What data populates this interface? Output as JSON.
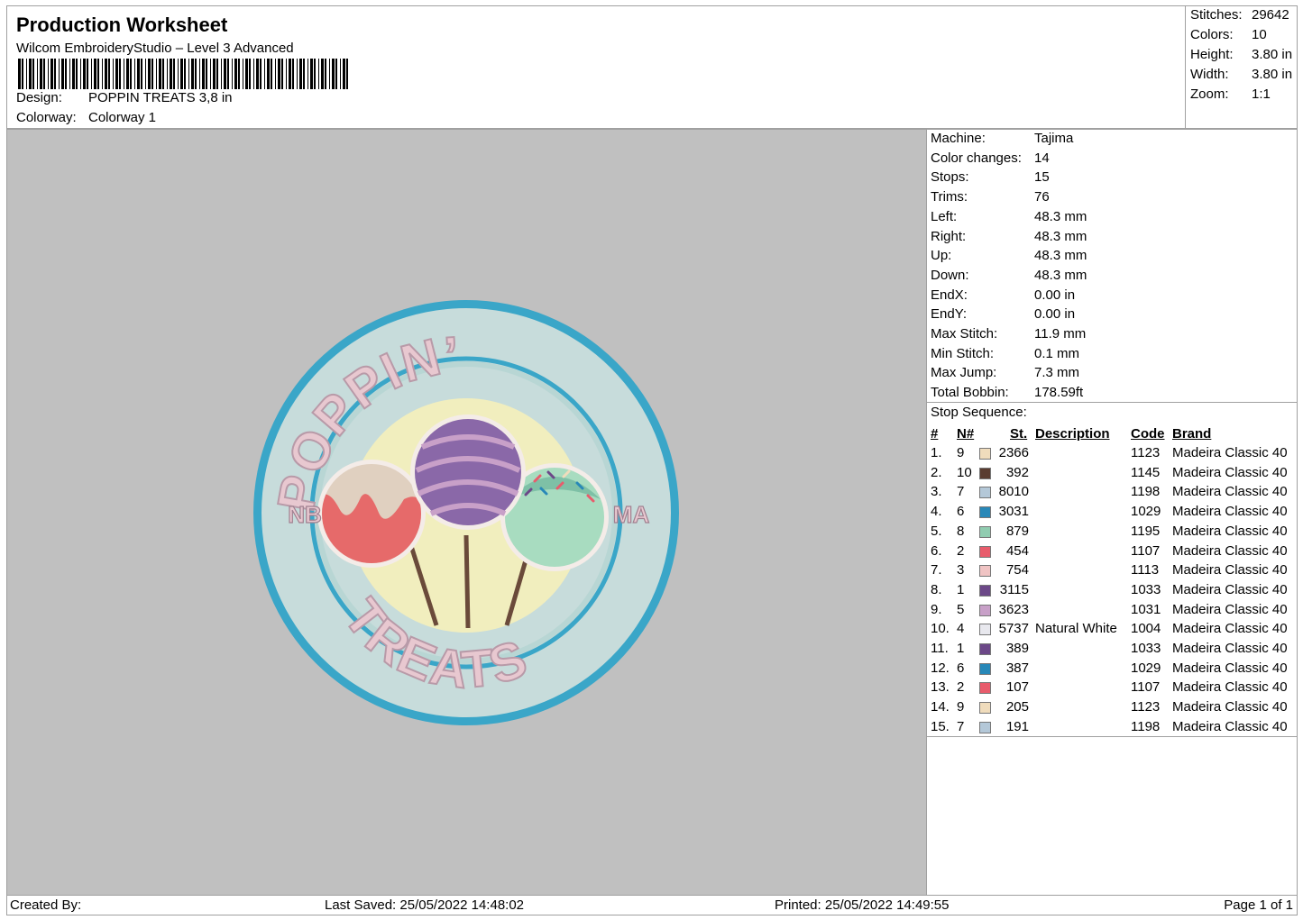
{
  "header": {
    "title": "Production Worksheet",
    "software": "Wilcom EmbroideryStudio – Level 3 Advanced",
    "design_label": "Design:",
    "design_value": "POPPIN TREATS 3,8 in",
    "colorway_label": "Colorway:",
    "colorway_value": "Colorway 1"
  },
  "summary": [
    {
      "label": "Stitches:",
      "value": "29642"
    },
    {
      "label": "Colors:",
      "value": "10"
    },
    {
      "label": "Height:",
      "value": "3.80 in"
    },
    {
      "label": "Width:",
      "value": "3.80 in"
    },
    {
      "label": "Zoom:",
      "value": "1:1"
    }
  ],
  "machine": [
    {
      "label": "Machine:",
      "value": "Tajima"
    },
    {
      "label": "Color changes:",
      "value": "14"
    },
    {
      "label": "Stops:",
      "value": "15"
    },
    {
      "label": "Trims:",
      "value": "76"
    },
    {
      "label": "Left:",
      "value": "48.3 mm"
    },
    {
      "label": "Right:",
      "value": "48.3 mm"
    },
    {
      "label": "Up:",
      "value": "48.3 mm"
    },
    {
      "label": "Down:",
      "value": "48.3 mm"
    },
    {
      "label": "EndX:",
      "value": "0.00 in"
    },
    {
      "label": "EndY:",
      "value": "0.00 in"
    },
    {
      "label": "Max Stitch:",
      "value": "11.9 mm"
    },
    {
      "label": "Min Stitch:",
      "value": "0.1 mm"
    },
    {
      "label": "Max Jump:",
      "value": "7.3 mm"
    },
    {
      "label": "Total Bobbin:",
      "value": "178.59ft"
    }
  ],
  "stop_sequence": {
    "title": "Stop Sequence:",
    "headers": {
      "num": "#",
      "n": "N#",
      "st": "St.",
      "desc": "Description",
      "code": "Code",
      "brand": "Brand"
    },
    "rows": [
      {
        "num": "1.",
        "n": "9",
        "color": "#f0dcbc",
        "st": "2366",
        "desc": "",
        "code": "1123",
        "brand": "Madeira Classic 40"
      },
      {
        "num": "2.",
        "n": "10",
        "color": "#5a3c30",
        "st": "392",
        "desc": "",
        "code": "1145",
        "brand": "Madeira Classic 40"
      },
      {
        "num": "3.",
        "n": "7",
        "color": "#b4c8d8",
        "st": "8010",
        "desc": "",
        "code": "1198",
        "brand": "Madeira Classic 40"
      },
      {
        "num": "4.",
        "n": "6",
        "color": "#2888b8",
        "st": "3031",
        "desc": "",
        "code": "1029",
        "brand": "Madeira Classic 40"
      },
      {
        "num": "5.",
        "n": "8",
        "color": "#90ccb0",
        "st": "879",
        "desc": "",
        "code": "1195",
        "brand": "Madeira Classic 40"
      },
      {
        "num": "6.",
        "n": "2",
        "color": "#e85c6c",
        "st": "454",
        "desc": "",
        "code": "1107",
        "brand": "Madeira Classic 40"
      },
      {
        "num": "7.",
        "n": "3",
        "color": "#f0c4c4",
        "st": "754",
        "desc": "",
        "code": "1113",
        "brand": "Madeira Classic 40"
      },
      {
        "num": "8.",
        "n": "1",
        "color": "#6c4888",
        "st": "3115",
        "desc": "",
        "code": "1033",
        "brand": "Madeira Classic 40"
      },
      {
        "num": "9.",
        "n": "5",
        "color": "#c8a0c8",
        "st": "3623",
        "desc": "",
        "code": "1031",
        "brand": "Madeira Classic 40"
      },
      {
        "num": "10.",
        "n": "4",
        "color": "#e8e8ee",
        "st": "5737",
        "desc": "Natural White",
        "code": "1004",
        "brand": "Madeira Classic 40"
      },
      {
        "num": "11.",
        "n": "1",
        "color": "#6c4888",
        "st": "389",
        "desc": "",
        "code": "1033",
        "brand": "Madeira Classic 40"
      },
      {
        "num": "12.",
        "n": "6",
        "color": "#2888b8",
        "st": "387",
        "desc": "",
        "code": "1029",
        "brand": "Madeira Classic 40"
      },
      {
        "num": "13.",
        "n": "2",
        "color": "#e85c6c",
        "st": "107",
        "desc": "",
        "code": "1107",
        "brand": "Madeira Classic 40"
      },
      {
        "num": "14.",
        "n": "9",
        "color": "#f0dcbc",
        "st": "205",
        "desc": "",
        "code": "1123",
        "brand": "Madeira Classic 40"
      },
      {
        "num": "15.",
        "n": "7",
        "color": "#b4c8d8",
        "st": "191",
        "desc": "",
        "code": "1198",
        "brand": "Madeira Classic 40"
      }
    ]
  },
  "design_preview": {
    "top_text": "POPPIN’",
    "bottom_text": "TREATS",
    "left_text": "NB",
    "right_text": "MA"
  },
  "footer": {
    "created": "Created By:",
    "saved": "Last Saved: 25/05/2022 14:48:02",
    "printed": "Printed: 25/05/2022 14:49:55",
    "page": "Page 1 of 1"
  }
}
